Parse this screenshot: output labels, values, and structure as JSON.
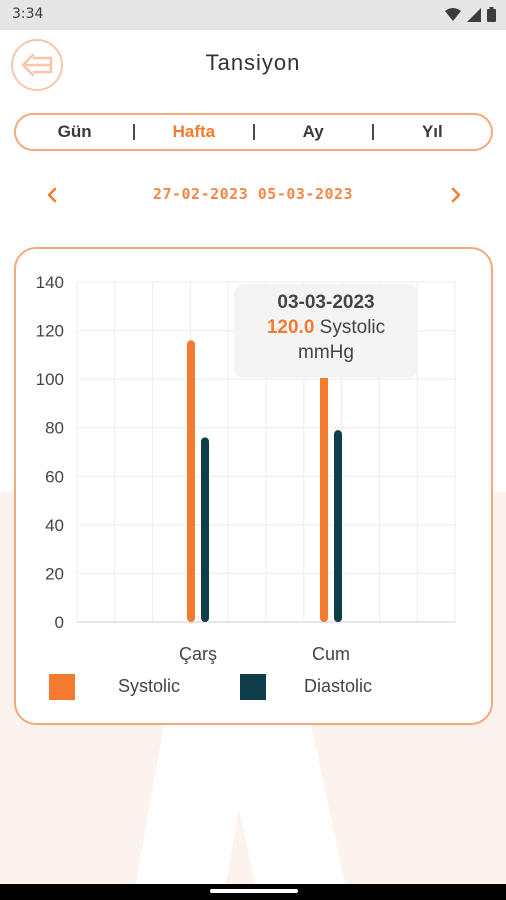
{
  "status_bar": {
    "time": "3:34",
    "icons": [
      "wifi-icon",
      "signal-icon",
      "battery-icon"
    ]
  },
  "header": {
    "title": "Tansiyon",
    "back_icon": "arrow-left-icon"
  },
  "period_tabs": [
    {
      "label": "Gün",
      "active": false
    },
    {
      "label": "Hafta",
      "active": true
    },
    {
      "label": "Ay",
      "active": false
    },
    {
      "label": "Yıl",
      "active": false
    }
  ],
  "date_nav": {
    "range": "27-02-2023 05-03-2023",
    "prev_icon": "chevron-left-icon",
    "next_icon": "chevron-right-icon"
  },
  "tooltip": {
    "date": "03-03-2023",
    "value": "120.0",
    "series": "Systolic",
    "unit": "mmHg"
  },
  "colors": {
    "accent": "#f47a30",
    "systolic": "#f47a30",
    "diastolic": "#0f3d4c",
    "border": "#f5a97a"
  },
  "chart_data": {
    "type": "bar",
    "categories": [
      "Çarş",
      "Cum"
    ],
    "series": [
      {
        "name": "Systolic",
        "values": [
          116,
          120
        ],
        "color": "#f47a30"
      },
      {
        "name": "Diastolic",
        "values": [
          76,
          79
        ],
        "color": "#0f3d4c"
      }
    ],
    "ylim": [
      0,
      140
    ],
    "yticks": [
      0,
      20,
      40,
      60,
      80,
      100,
      120,
      140
    ],
    "grid": true,
    "legend_position": "bottom"
  }
}
